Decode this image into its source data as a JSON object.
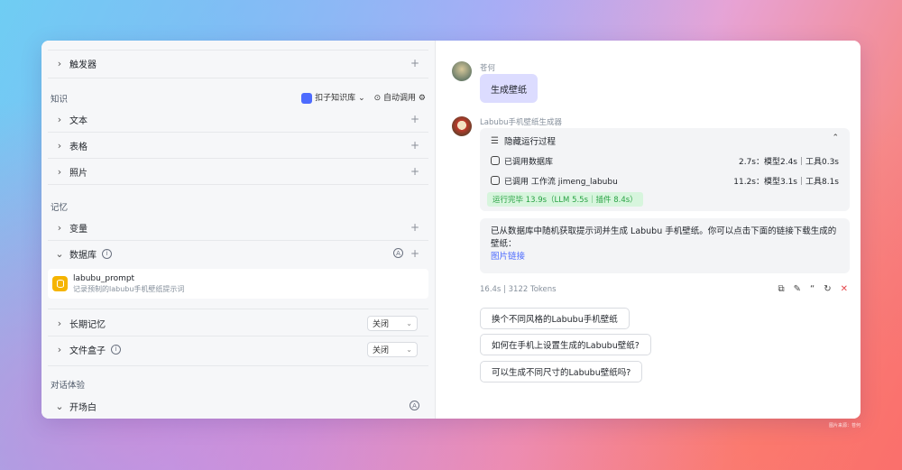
{
  "left": {
    "trigger": "触发器",
    "knowledge_section": "知识",
    "kb_button": "扣子知识库",
    "auto_call": "自动调用",
    "text": "文本",
    "table": "表格",
    "photo": "照片",
    "memory_section": "记忆",
    "variable": "变量",
    "database": "数据库",
    "db_item": {
      "name": "labubu_prompt",
      "desc": "记录预制的labubu手机壁纸提示词"
    },
    "long_memory": "长期记忆",
    "long_memory_value": "关闭",
    "filebox": "文件盒子",
    "filebox_value": "关闭",
    "dialog_section": "对话体验",
    "opening": "开场白"
  },
  "chat": {
    "user_name": "苍何",
    "user_msg": "生成壁纸",
    "bot_name": "Labubu手机壁纸生成器",
    "process": {
      "title": "隐藏运行过程",
      "step1": "已调用数据库",
      "step1_time": "2.7s：模型2.4s｜工具0.3s",
      "step2": "已调用 工作流 jimeng_labubu",
      "step2_time": "11.2s：模型3.1s｜工具8.1s",
      "done": "运行完毕 13.9s（LLM 5.5s｜插件 8.4s）"
    },
    "answer": "已从数据库中随机获取提示词并生成 Labubu 手机壁纸。你可以点击下面的链接下载生成的壁纸：",
    "answer_link": "图片链接",
    "meta": "16.4s  |  3122 Tokens",
    "suggestions": [
      "换个不同风格的Labubu手机壁纸",
      "如何在手机上设置生成的Labubu壁纸?",
      "可以生成不同尺寸的Labubu壁纸吗?"
    ]
  },
  "watermark": "图片来源：苍何"
}
